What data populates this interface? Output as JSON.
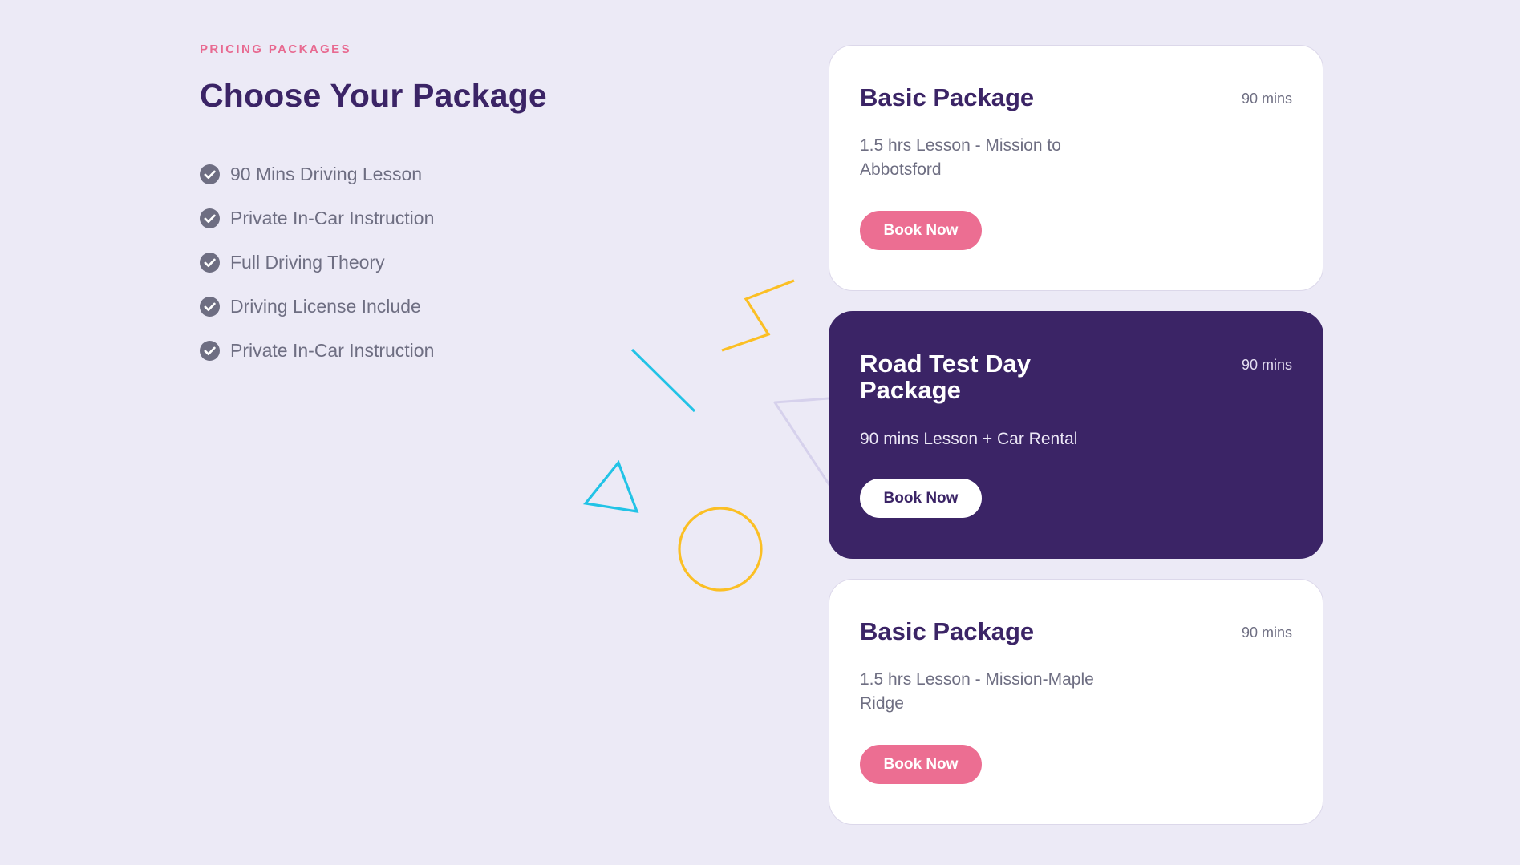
{
  "section": {
    "eyebrow": "PRICING PACKAGES",
    "title": "Choose Your Package"
  },
  "features": [
    {
      "text": "90 Mins Driving Lesson",
      "icon": "check-circle-icon"
    },
    {
      "text": "Private In-Car Instruction",
      "icon": "check-circle-icon"
    },
    {
      "text": "Full Driving Theory",
      "icon": "check-circle-icon"
    },
    {
      "text": "Driving License Include",
      "icon": "check-circle-icon"
    },
    {
      "text": "Private In-Car Instruction",
      "icon": "check-circle-icon"
    }
  ],
  "packages": [
    {
      "title": "Basic Package",
      "duration": "90 mins",
      "description": "1.5 hrs Lesson - Mission to Abbotsford",
      "button_label": "Book Now",
      "featured": false
    },
    {
      "title": "Road Test Day Package",
      "duration": "90 mins",
      "description": "90 mins Lesson + Car Rental",
      "button_label": "Book Now",
      "featured": true
    },
    {
      "title": "Basic Package",
      "duration": "90 mins",
      "description": "1.5 hrs Lesson - Mission-Maple Ridge",
      "button_label": "Book Now",
      "featured": false
    }
  ],
  "colors": {
    "background": "#ECEAF6",
    "brand_purple": "#3B2466",
    "accent_pink": "#EC6E92",
    "decor_yellow": "#FBBF24",
    "decor_cyan": "#22C3E6",
    "text_gray": "#6E6E82"
  }
}
